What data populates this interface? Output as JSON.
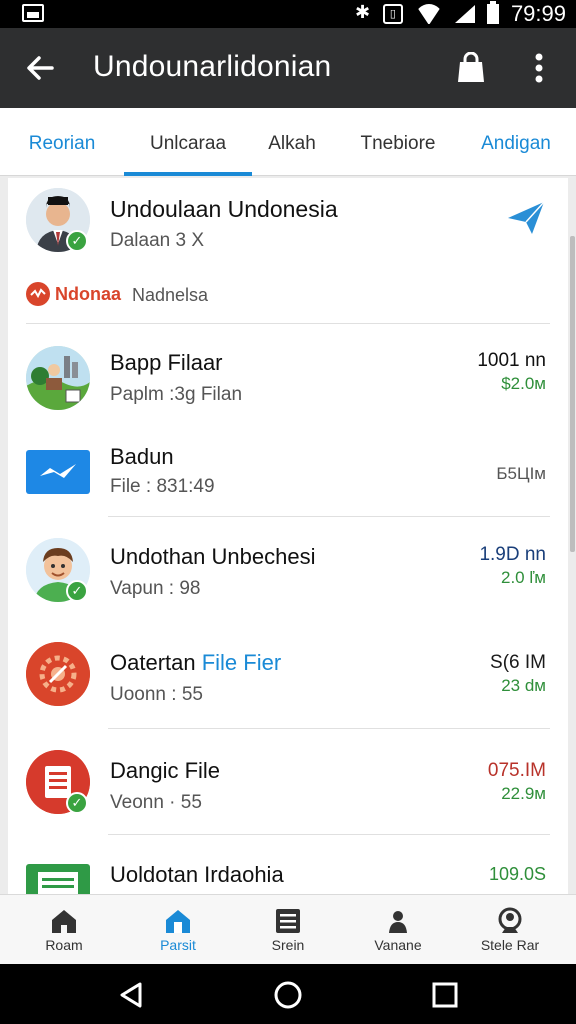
{
  "status_bar": {
    "time": "79:99",
    "icons": [
      "screenshot-icon",
      "bluetooth-icon",
      "vibrate-icon",
      "wifi-icon",
      "signal-icon",
      "battery-icon"
    ]
  },
  "app_bar": {
    "title": "Undounarlidonian",
    "icons": [
      "back-arrow-icon",
      "shopping-bag-icon",
      "more-vert-icon"
    ]
  },
  "tabs": [
    {
      "label": "Reorian"
    },
    {
      "label": "Unlcaraa"
    },
    {
      "label": "Alkah"
    },
    {
      "label": "Tnebiore"
    },
    {
      "label": "Andigan"
    }
  ],
  "profile": {
    "name": "Undoulaan Undonesia",
    "subtitle": "Dalaan 3 X",
    "source_label": "Ndonaa",
    "source_text": "Nadnelsa"
  },
  "items": [
    {
      "title": "Bapp Filaar",
      "title_accent": "",
      "subtitle": "Paplm :3g Filan",
      "value": "1001 nn",
      "value_secondary": "$2.0м",
      "icon": "landscape-icon"
    },
    {
      "title": "Badun",
      "title_accent": "",
      "subtitle": "File : 831:49",
      "value": "",
      "value_secondary": "Б5ЦІм",
      "icon": "email-icon"
    },
    {
      "title": "Undothan Unbechesi",
      "title_accent": "",
      "subtitle": "Vapun : 98",
      "value": "1.9D nn",
      "value_secondary": "2.0 ľм",
      "icon": "person-avatar-icon"
    },
    {
      "title": "Oatertan ",
      "title_accent": "File Fier",
      "subtitle": "Uoonn : 55",
      "value": "S(6 IM",
      "value_secondary": "23 dм",
      "icon": "settings-icon"
    },
    {
      "title": "Dangic File",
      "title_accent": "",
      "subtitle": "Veonn · 55",
      "value": "075.IM",
      "value_secondary": "22.9м",
      "icon": "document-icon"
    },
    {
      "title": "Uoldotan Irdaohia",
      "title_accent": "",
      "subtitle": "",
      "value": "",
      "value_secondary": "109.0S",
      "icon": "spreadsheet-icon"
    }
  ],
  "bottom_nav": [
    {
      "label": "Roam",
      "icon": "home-icon"
    },
    {
      "label": "Parsit",
      "icon": "home-active-icon"
    },
    {
      "label": "Srein",
      "icon": "list-icon"
    },
    {
      "label": "Vanane",
      "icon": "person-icon"
    },
    {
      "label": "Stele Rar",
      "icon": "profile-icon"
    }
  ],
  "colors": {
    "accent": "#1a8ad6",
    "app_bar": "#2e2f30",
    "positive": "#2f8f3a",
    "negative": "#c0392b",
    "brand_red": "#d9452b"
  }
}
